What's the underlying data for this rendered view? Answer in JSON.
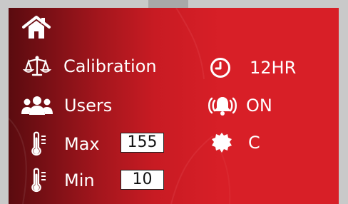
{
  "colors": {
    "panel_red": "#d81f27",
    "panel_dark": "#5a0b0f",
    "text": "#ffffff",
    "field_bg": "#ffffff",
    "field_text": "#111111"
  },
  "icons": {
    "home": "home-icon",
    "calibration": "scale-icon",
    "users": "users-icon",
    "max": "thermometer-icon",
    "min": "thermometer-icon",
    "clock": "clock-icon",
    "alarm": "alarm-bell-icon",
    "units": "gear-badge-icon"
  },
  "menu": {
    "calibration": "Calibration",
    "users": "Users",
    "max": "Max",
    "min": "Min"
  },
  "fields": {
    "max_value": "155",
    "min_value": "10"
  },
  "settings": {
    "time_format": "12HR",
    "alarm": "ON",
    "unit": "C"
  }
}
